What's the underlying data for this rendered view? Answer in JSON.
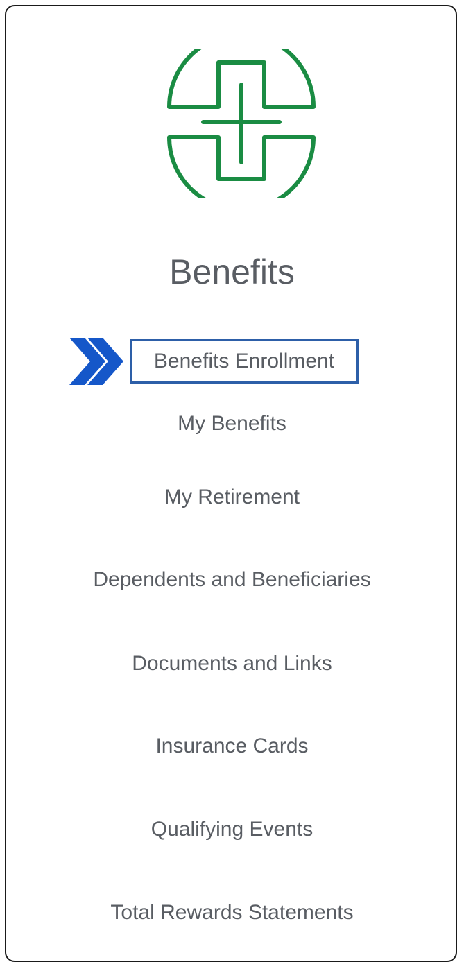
{
  "page": {
    "title": "Benefits"
  },
  "logo": {
    "icon": "benefits-cross-logo-icon",
    "color": "#1a8c43"
  },
  "pointer": {
    "icon": "double-chevron-right-icon",
    "color": "#1557c9"
  },
  "highlight": {
    "color": "#2d5fa8"
  },
  "menu": {
    "items": [
      {
        "label": "Benefits Enrollment",
        "highlighted": true
      },
      {
        "label": "My Benefits"
      },
      {
        "label": "My Retirement"
      },
      {
        "label": "Dependents and Beneficiaries"
      },
      {
        "label": "Documents and Links"
      },
      {
        "label": "Insurance Cards"
      },
      {
        "label": "Qualifying Events"
      },
      {
        "label": "Total Rewards Statements"
      }
    ]
  }
}
